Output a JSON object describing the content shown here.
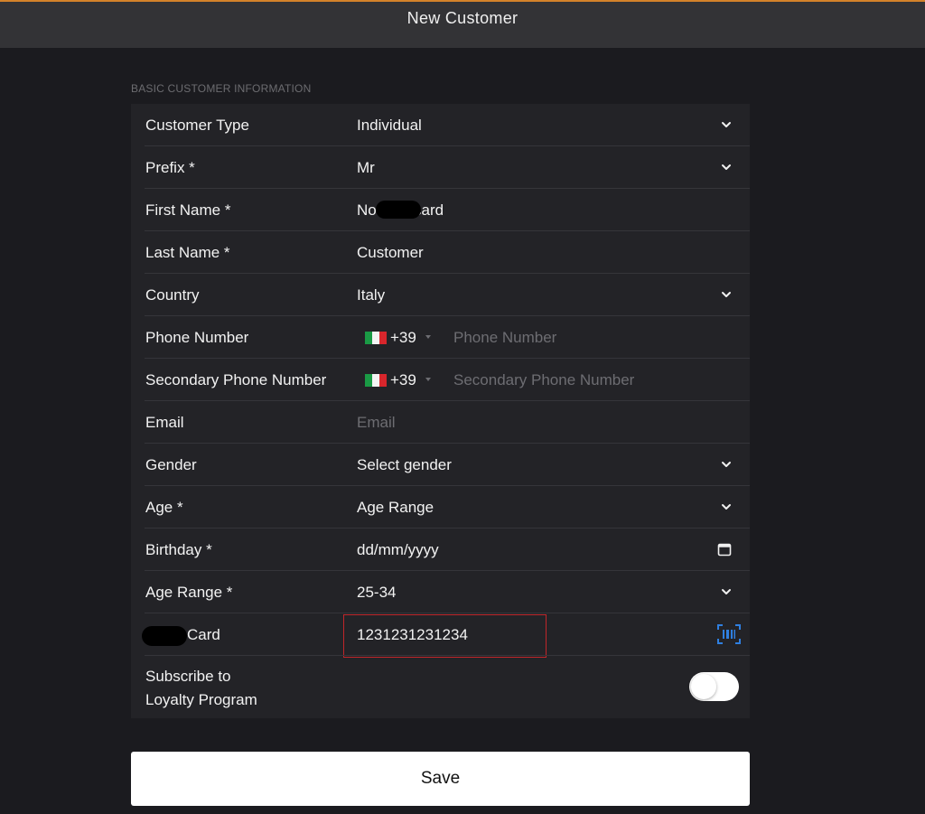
{
  "header": {
    "title": "New Customer",
    "accent_color": "#d4822a"
  },
  "section_label": "BASIC CUSTOMER INFORMATION",
  "fields": {
    "customer_type": {
      "label": "Customer Type",
      "value": "Individual"
    },
    "prefix": {
      "label": "Prefix *",
      "value": "Mr"
    },
    "first_name": {
      "label": "First Name *",
      "value_start": "No",
      "value_end": "card"
    },
    "last_name": {
      "label": "Last Name *",
      "value": "Customer"
    },
    "country": {
      "label": "Country",
      "value": "Italy"
    },
    "phone": {
      "label": "Phone Number",
      "country_code": "+39",
      "placeholder": "Phone Number"
    },
    "secondary_phone": {
      "label": "Secondary Phone Number",
      "country_code": "+39",
      "placeholder": "Secondary Phone Number"
    },
    "email": {
      "label": "Email",
      "placeholder": "Email"
    },
    "gender": {
      "label": "Gender",
      "value": "Select gender"
    },
    "age": {
      "label": "Age *",
      "value": "Age Range"
    },
    "birthday": {
      "label": "Birthday *",
      "value": "dd/mm/yyyy"
    },
    "age_range": {
      "label": "Age Range *",
      "value": "25-34"
    },
    "card": {
      "label_suffix": "Card",
      "value": "1231231231234",
      "highlight_color": "#c0262a",
      "scan_icon_color": "#2f7fe0"
    },
    "loyalty": {
      "label_line1": "Subscribe to",
      "label_line2": "Loyalty Program",
      "enabled": false
    }
  },
  "icons": {
    "dropdown": "chevron-down-icon",
    "calendar": "calendar-icon",
    "scan": "barcode-scan-icon",
    "flag": "italy-flag-icon"
  },
  "save_label": "Save"
}
